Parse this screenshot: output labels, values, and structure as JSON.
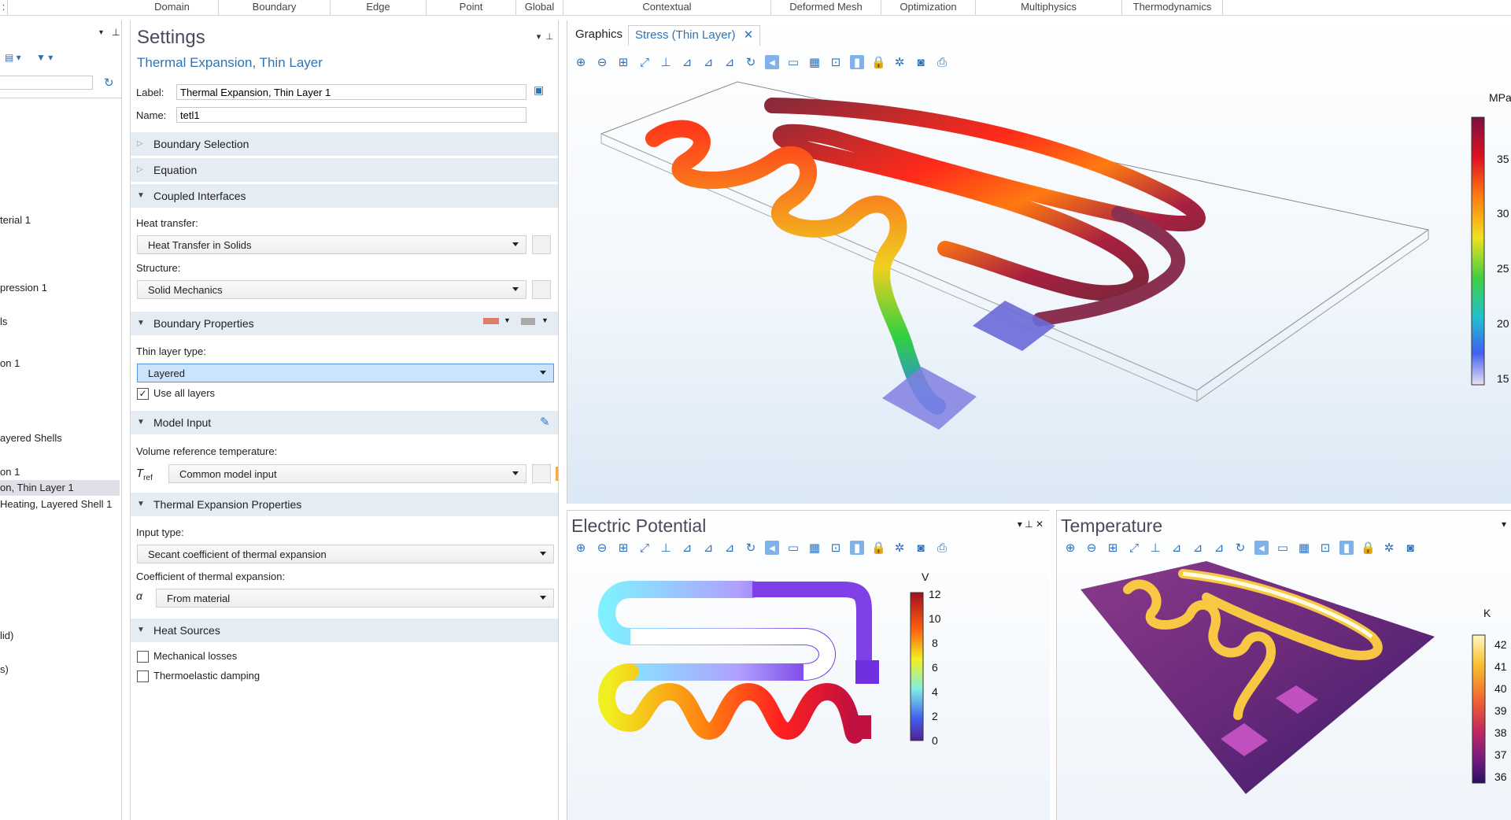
{
  "ribbon": {
    "tabs": [
      "Domain",
      "Boundary",
      "Edge",
      "Point",
      "Global",
      "Contextual",
      "Deformed Mesh",
      "Optimization",
      "Multiphysics",
      "Thermodynamics"
    ]
  },
  "tree": {
    "items": [
      "terial 1",
      "pression 1",
      "ls",
      "on 1",
      "ayered Shells",
      "on 1",
      "on, Thin Layer 1",
      "Heating, Layered Shell 1",
      "lid)",
      "s)"
    ]
  },
  "settings": {
    "title": "Settings",
    "subtitle": "Thermal Expansion, Thin Layer",
    "label_caption": "Label:",
    "label_value": "Thermal Expansion, Thin Layer 1",
    "name_caption": "Name:",
    "name_value": "tetl1",
    "sections": {
      "boundary_selection": "Boundary Selection",
      "equation": "Equation",
      "coupled_interfaces": "Coupled Interfaces",
      "boundary_properties": "Boundary Properties",
      "model_input": "Model Input",
      "thermal_expansion_properties": "Thermal Expansion Properties",
      "heat_sources": "Heat Sources"
    },
    "heat_transfer_caption": "Heat transfer:",
    "heat_transfer_value": "Heat Transfer in Solids",
    "structure_caption": "Structure:",
    "structure_value": "Solid Mechanics",
    "thin_layer_caption": "Thin layer type:",
    "thin_layer_value": "Layered",
    "use_all_layers": "Use all layers",
    "vol_ref_caption": "Volume reference temperature:",
    "tref_symbol": "T",
    "tref_sub": "ref",
    "tref_value": "Common model input",
    "input_type_caption": "Input type:",
    "input_type_value": "Secant coefficient of thermal expansion",
    "cte_caption": "Coefficient of thermal expansion:",
    "alpha_symbol": "α",
    "cte_value": "From material",
    "mech_losses": "Mechanical losses",
    "thermo_damping": "Thermoelastic damping"
  },
  "graphics": {
    "tab_graphics": "Graphics",
    "tab_stress": "Stress (Thin Layer)",
    "unit": "MPa",
    "ticks": [
      "35",
      "30",
      "25",
      "20",
      "15"
    ]
  },
  "electric": {
    "title": "Electric Potential",
    "unit": "V",
    "ticks": [
      "12",
      "10",
      "8",
      "6",
      "4",
      "2",
      "0"
    ]
  },
  "temperature": {
    "title": "Temperature",
    "unit": "K",
    "ticks": [
      "42",
      "41",
      "40",
      "39",
      "38",
      "37",
      "36"
    ]
  },
  "colors": {
    "section_bg": "#e6ecf4",
    "accent": "#2e74b5",
    "highlight": "#cce4fb"
  }
}
